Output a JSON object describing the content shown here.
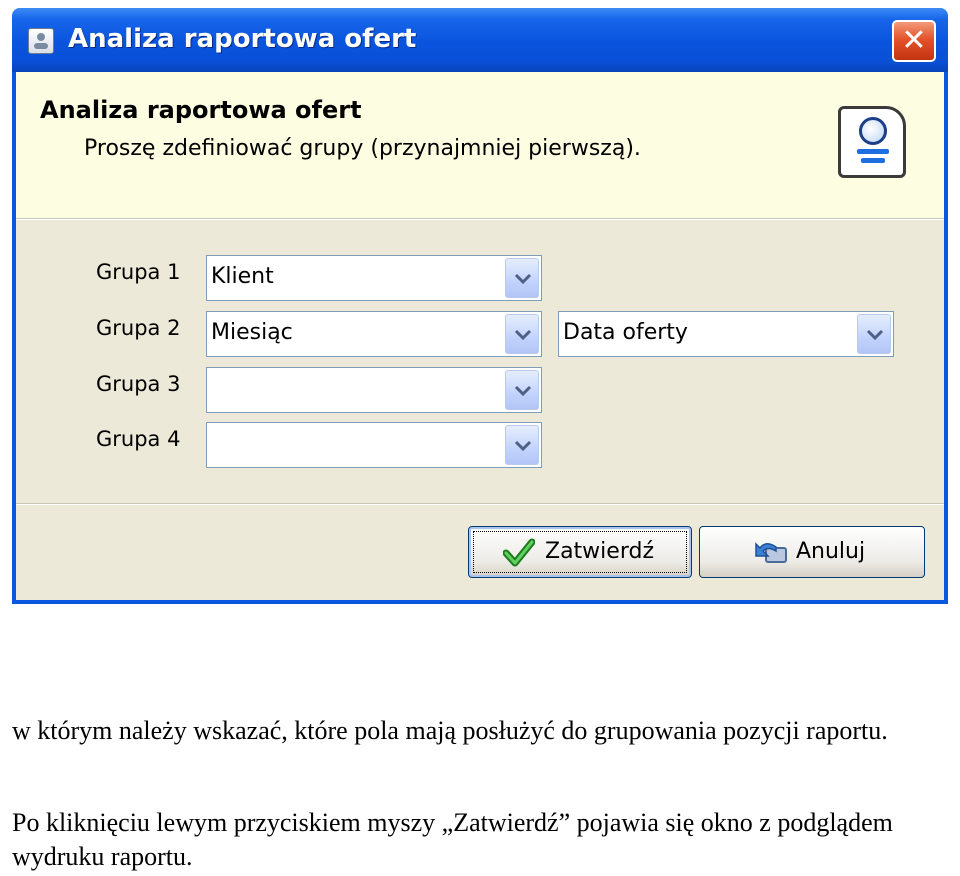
{
  "dialog": {
    "title": "Analiza raportowa ofert",
    "header_title": "Analiza raportowa ofert",
    "header_subtitle": "Proszę zdefiniować grupy (przynajmniej pierwszą).",
    "groups": [
      {
        "label": "Grupa 1",
        "value": "Klient",
        "secondary_value": null
      },
      {
        "label": "Grupa 2",
        "value": "Miesiąc",
        "secondary_value": "Data oferty"
      },
      {
        "label": "Grupa 3",
        "value": "",
        "secondary_value": null
      },
      {
        "label": "Grupa 4",
        "value": "",
        "secondary_value": null
      }
    ],
    "buttons": {
      "confirm_label": "Zatwierdź",
      "cancel_label": "Anuluj"
    },
    "icons": {
      "app": "dialog-app-icon",
      "close": "close-icon",
      "wizard": "wizard-magnifier-icon",
      "dropdown": "chevron-down-icon",
      "confirm": "checkmark-icon",
      "cancel": "undo-arrow-icon"
    },
    "colors": {
      "titlebar": "#0a54dd",
      "client_bg": "#ece9d8",
      "header_bg": "#fdfde2",
      "close_button": "#e4532a"
    }
  },
  "document": {
    "paragraph1": "w którym należy wskazać, które pola mają posłużyć do grupowania pozycji raportu.",
    "paragraph2": "Po kliknięciu lewym przyciskiem myszy „Zatwierdź” pojawia się okno z podglądem wydruku raportu."
  }
}
